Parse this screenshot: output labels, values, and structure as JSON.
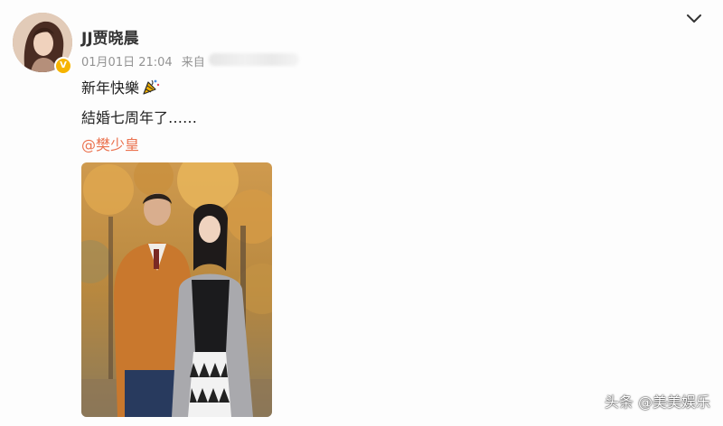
{
  "post": {
    "username": "JJ贾晓晨",
    "timestamp": "01月01日 21:04",
    "source_label": "来自",
    "line1": "新年快樂",
    "line1_emoji": "party-popper-icon",
    "line2": "結婚七周年了……",
    "mention": "@樊少皇"
  },
  "watermark": "头条 @美美娱乐",
  "colors": {
    "mention": "#eb7350",
    "verified_badge": "#f6b400",
    "username": "#333333",
    "meta": "#939393"
  }
}
